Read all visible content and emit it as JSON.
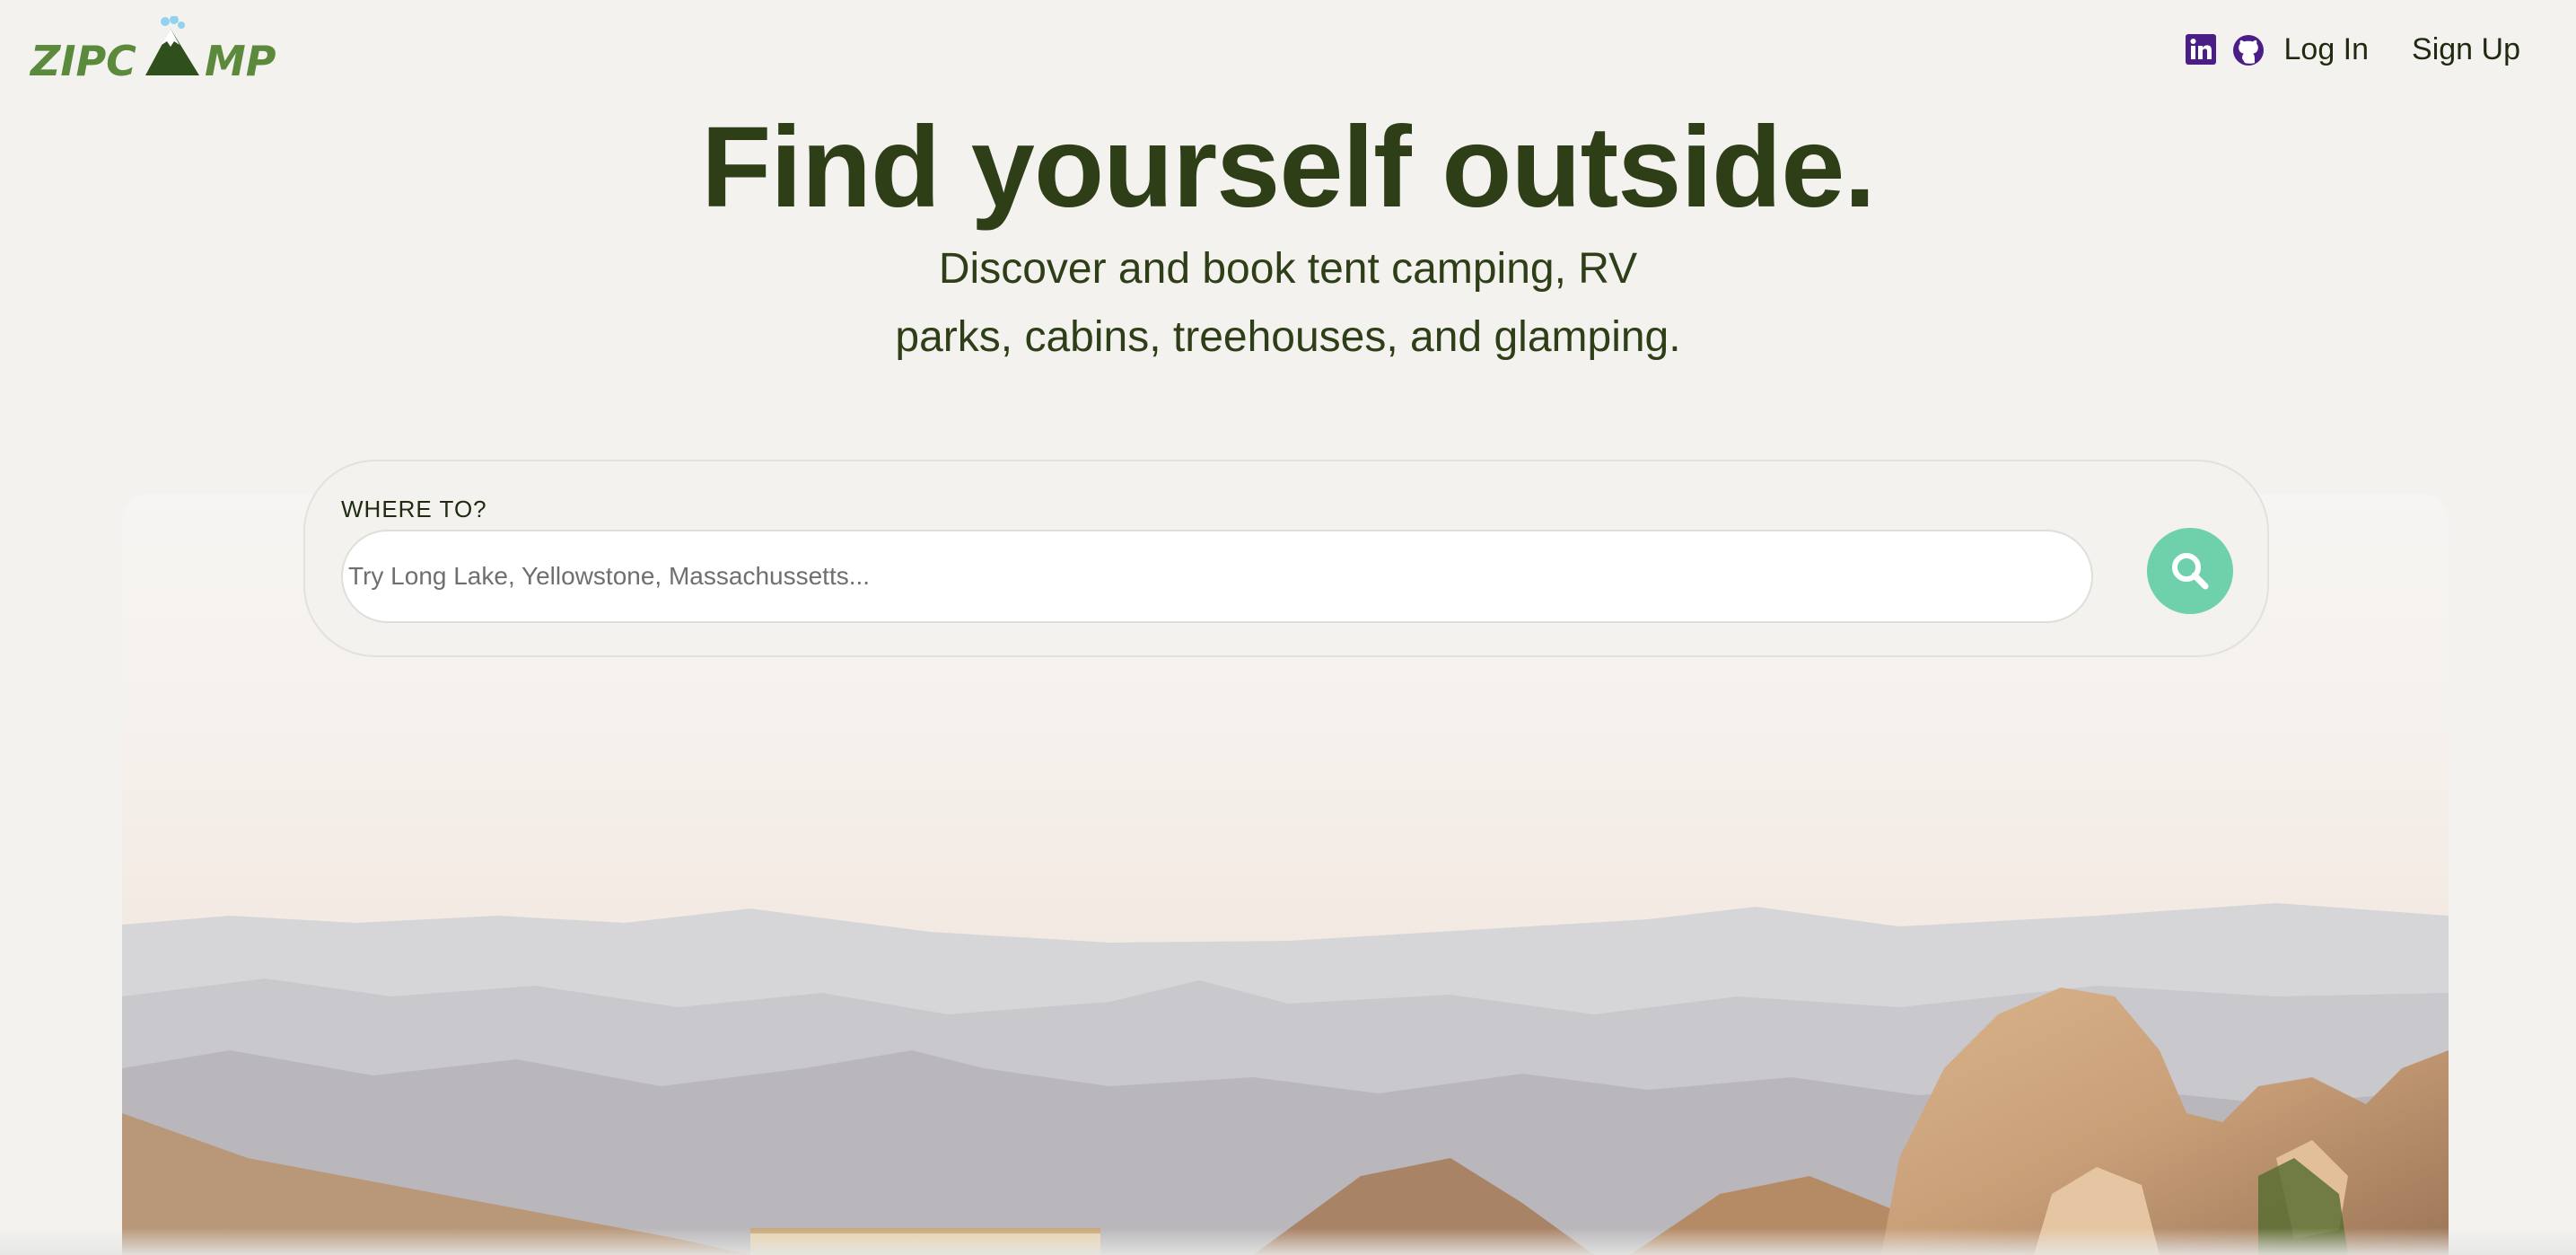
{
  "brand": {
    "logo_text": "ZIPCAMP",
    "primary_color": "#2e3e17",
    "accent_color": "#6fd1ab",
    "logo_color": "#5b8a3c"
  },
  "nav": {
    "linkedin_icon": "linkedin-icon",
    "github_icon": "github-icon",
    "icon_color": "#4a1e86",
    "login_label": "Log In",
    "signup_label": "Sign Up"
  },
  "hero": {
    "title": "Find yourself outside.",
    "subtitle_line1": "Discover and book tent camping, RV",
    "subtitle_line2": "parks, cabins, treehouses, and glamping."
  },
  "search": {
    "label": "WHERE TO?",
    "placeholder": "Try Long Lake, Yellowstone, Massachussetts...",
    "value": "",
    "button_icon": "search-icon"
  }
}
